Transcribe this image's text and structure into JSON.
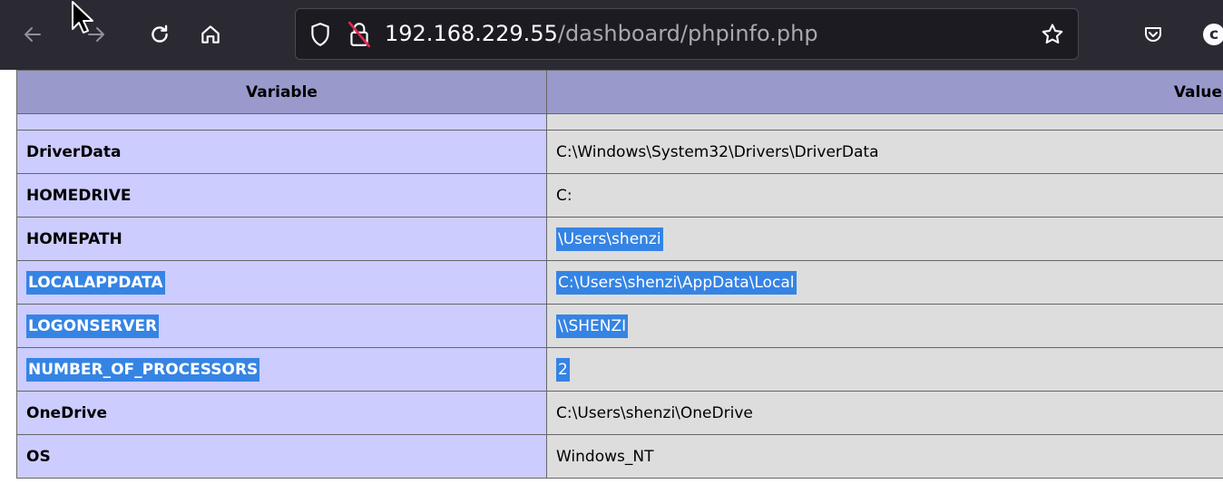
{
  "browser": {
    "url_host": "192.168.229.55",
    "url_path": "/dashboard/phpinfo.php",
    "account_initial": "c",
    "icons": {
      "back": "arrow-left-icon",
      "forward": "arrow-right-icon",
      "reload": "reload-icon",
      "home": "home-icon",
      "tracking": "shield-icon",
      "insecure": "insecure-lock-icon",
      "bookmark": "star-icon",
      "pocket": "pocket-icon"
    },
    "colors": {
      "toolbar": "#2b2a33",
      "urlbar": "#1c1b22"
    }
  },
  "table": {
    "headers": {
      "variable": "Variable",
      "value": "Value"
    },
    "rows": [
      {
        "name": "DriverData",
        "value": "C:\\Windows\\System32\\Drivers\\DriverData",
        "selected": false
      },
      {
        "name": "HOMEDRIVE",
        "value": "C:",
        "selected": false
      },
      {
        "name": "HOMEPATH",
        "value": "\\Users\\shenzi",
        "selected": "value"
      },
      {
        "name": "LOCALAPPDATA",
        "value": "C:\\Users\\shenzi\\AppData\\Local",
        "selected": true
      },
      {
        "name": "LOGONSERVER",
        "value": "\\\\SHENZI",
        "selected": true
      },
      {
        "name": "NUMBER_OF_PROCESSORS",
        "value": "2",
        "selected": true
      },
      {
        "name": "OneDrive",
        "value": "C:\\Users\\shenzi\\OneDrive",
        "selected": false
      },
      {
        "name": "OS",
        "value": "Windows_NT",
        "selected": false
      }
    ],
    "colors": {
      "header": "#9999cc",
      "name_cell": "#ccccff",
      "value_cell": "#dddddd",
      "selection": "#3584e4"
    }
  }
}
